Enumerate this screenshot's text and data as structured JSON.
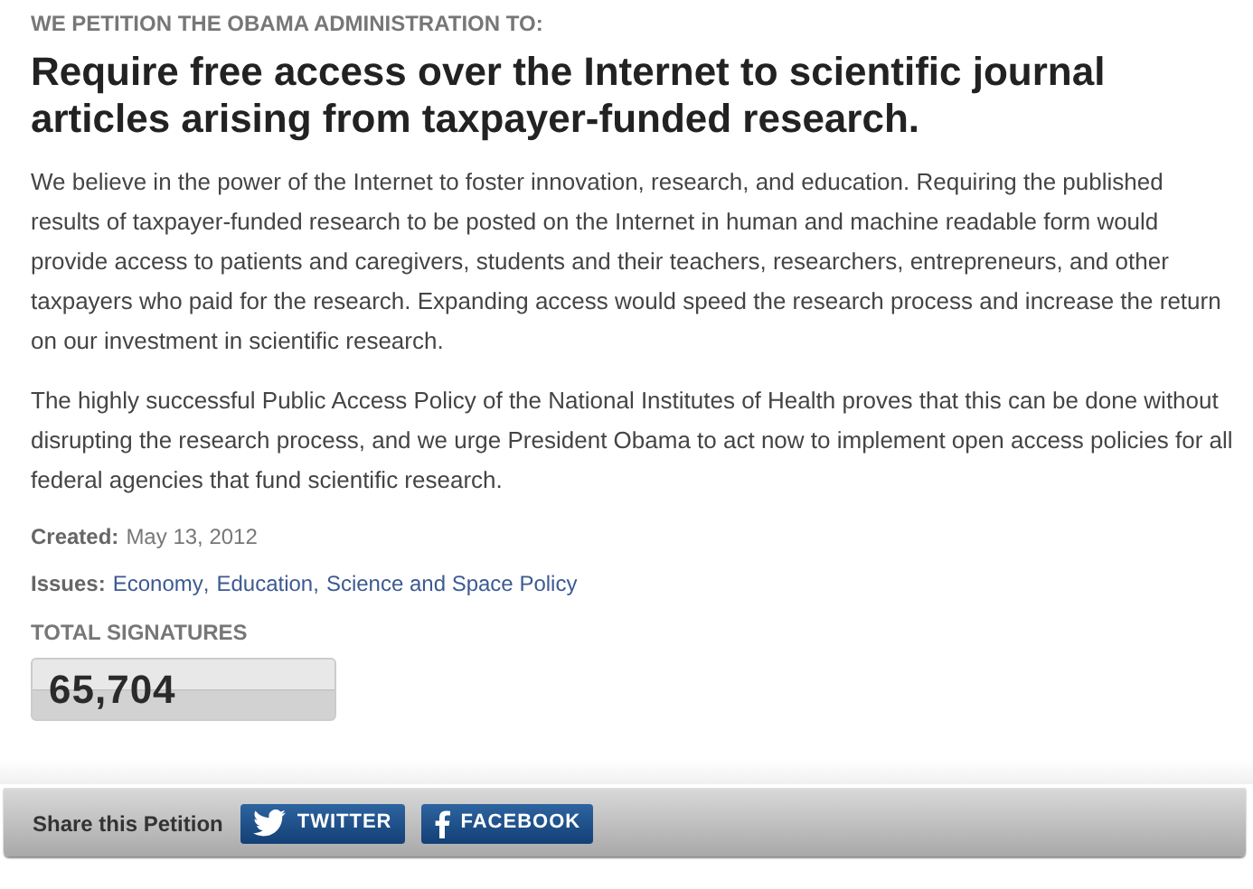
{
  "kicker": "WE PETITION THE OBAMA ADMINISTRATION TO:",
  "title": "Require free access over the Internet to scientific journal articles arising from taxpayer-funded research.",
  "paragraphs": [
    "We believe in the power of the Internet to foster innovation, research, and education. Requiring the published results of taxpayer-funded research to be posted on the Internet in human and machine readable form would provide access to patients and caregivers, students and their teachers, researchers, entrepreneurs, and other taxpayers who paid for the research. Expanding access would speed the research process and increase the return on our investment in scientific research.",
    "The highly successful Public Access Policy of the National Institutes of Health proves that this can be done without disrupting the research process, and we urge President Obama to act now to implement open access policies for all federal agencies that fund scientific research."
  ],
  "created": {
    "label": "Created:",
    "value": "May 13, 2012"
  },
  "issues": {
    "label": "Issues:",
    "links": [
      "Economy",
      "Education",
      "Science and Space Policy"
    ],
    "separator": ","
  },
  "signatures": {
    "label": "TOTAL SIGNATURES",
    "count": "65,704"
  },
  "share": {
    "label": "Share this Petition",
    "buttons": [
      {
        "kind": "twitter",
        "label": "TWITTER"
      },
      {
        "kind": "facebook",
        "label": "FACEBOOK"
      }
    ]
  }
}
